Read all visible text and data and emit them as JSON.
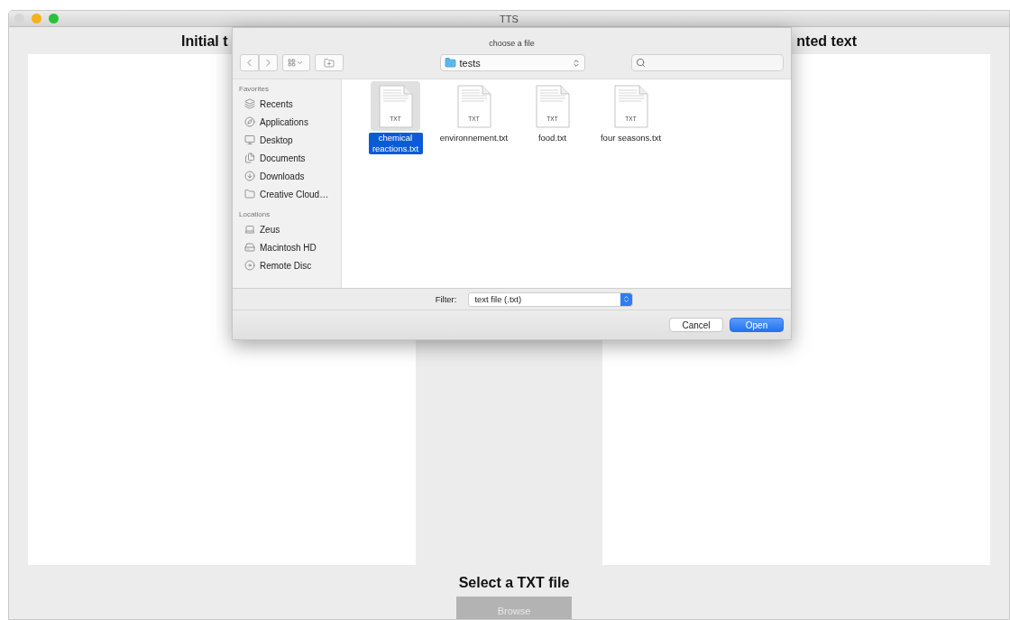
{
  "window": {
    "title": "TTS",
    "controls": [
      {
        "color": "#d6d6d6"
      },
      {
        "color": "#f6b21c"
      },
      {
        "color": "#29c33b"
      }
    ]
  },
  "panels": [
    {
      "heading": "Initial t"
    },
    {
      "heading": "nted text"
    }
  ],
  "file_section": {
    "label": "Select a TXT file",
    "button": {
      "label": "Browse",
      "disabled": true
    }
  },
  "dialog": {
    "title": "choose a file",
    "location": "tests",
    "sidebar": [
      {
        "heading": "Favorites",
        "items": [
          {
            "label": "Recents",
            "kind": "recents",
            "selected": false
          },
          {
            "label": "Applications",
            "kind": "applications",
            "selected": false
          },
          {
            "label": "Desktop",
            "kind": "desktop",
            "selected": false
          },
          {
            "label": "Documents",
            "kind": "documents",
            "selected": false
          },
          {
            "label": "Downloads",
            "kind": "downloads",
            "selected": false
          },
          {
            "label": "Creative Cloud…",
            "kind": "folder",
            "selected": false
          }
        ]
      },
      {
        "heading": "Locations",
        "items": [
          {
            "label": "Zeus",
            "kind": "computer",
            "selected": false
          },
          {
            "label": "Macintosh HD",
            "kind": "disk",
            "selected": false
          },
          {
            "label": "Remote Disc",
            "kind": "disc",
            "selected": false
          }
        ]
      }
    ],
    "files": [
      {
        "name": "chemical reactions.txt",
        "type": "TXT",
        "selected": true
      },
      {
        "name": "environnement.txt",
        "type": "TXT",
        "selected": false
      },
      {
        "name": "food.txt",
        "type": "TXT",
        "selected": false
      },
      {
        "name": "four seasons.txt",
        "type": "TXT",
        "selected": false
      }
    ],
    "filter": {
      "label": "Filter:",
      "value": "text file (.txt)"
    },
    "buttons": [
      {
        "label": "Cancel",
        "kind": "secondary"
      },
      {
        "label": "Open",
        "kind": "default"
      }
    ]
  }
}
